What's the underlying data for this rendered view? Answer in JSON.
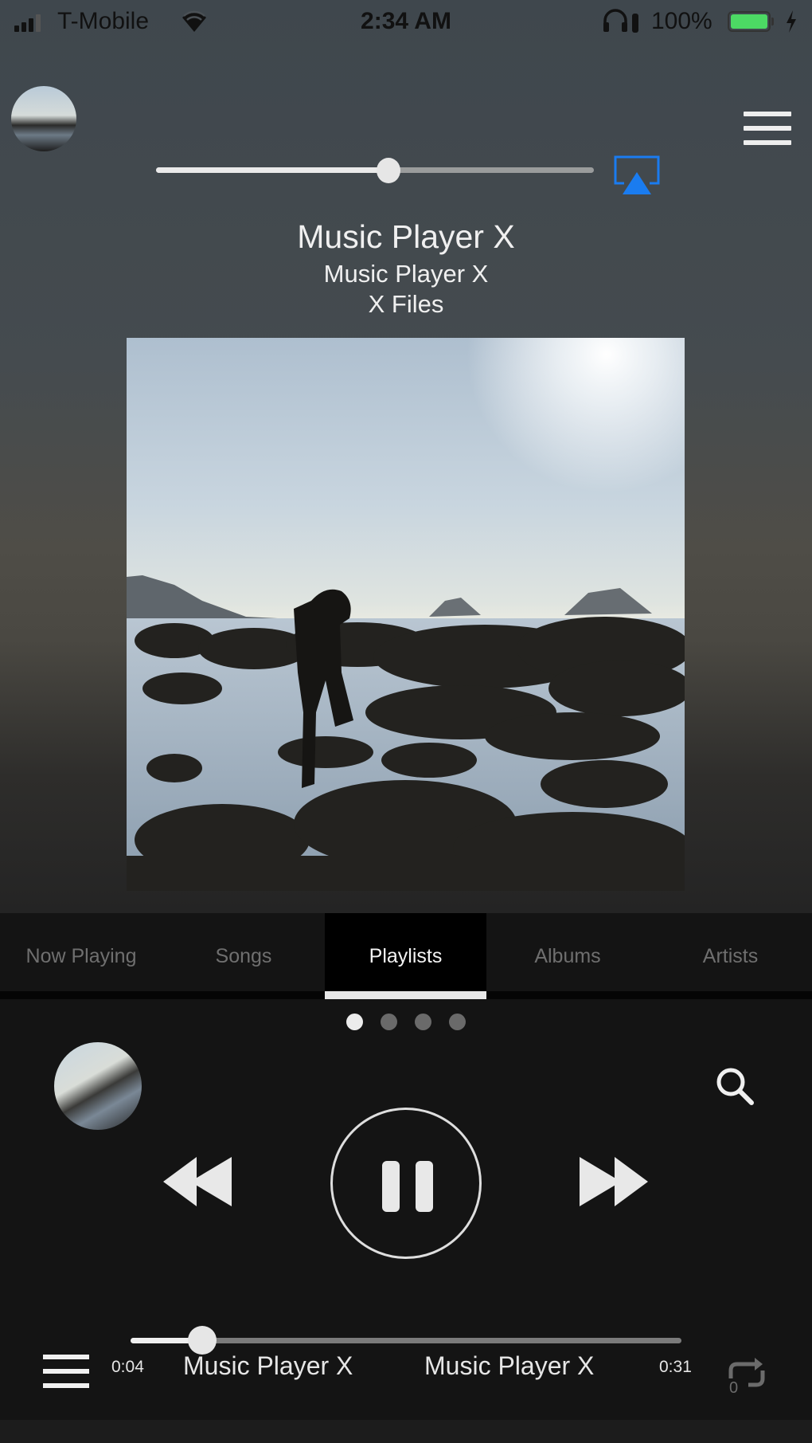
{
  "status_bar": {
    "carrier": "T-Mobile",
    "time": "2:34 AM",
    "battery_percent": "100%",
    "signal_bars": 3,
    "icons": [
      "signal-icon",
      "wifi-icon",
      "headphones-icon",
      "battery-icon",
      "charging-bolt-icon"
    ],
    "battery_color": "#4cd964"
  },
  "header": {
    "volume": 0.53,
    "airplay_color": "#1a7cf0"
  },
  "now_playing": {
    "title": "Music Player X",
    "artist": "Music Player X",
    "album": "X Files"
  },
  "tabs": [
    {
      "label": "Now Playing",
      "active": false
    },
    {
      "label": "Songs",
      "active": false
    },
    {
      "label": "Playlists",
      "active": true
    },
    {
      "label": "Albums",
      "active": false
    },
    {
      "label": "Artists",
      "active": false
    }
  ],
  "page_indicator": {
    "count": 4,
    "active_index": 0
  },
  "controls": {
    "state": "playing",
    "buttons": [
      "rewind",
      "pause",
      "fast-forward"
    ]
  },
  "mini_player": {
    "elapsed": "0:04",
    "total": "0:31",
    "progress": 0.13,
    "song_title": "Music Player X",
    "song_artist": "Music Player X",
    "repeat_mode": "0"
  }
}
